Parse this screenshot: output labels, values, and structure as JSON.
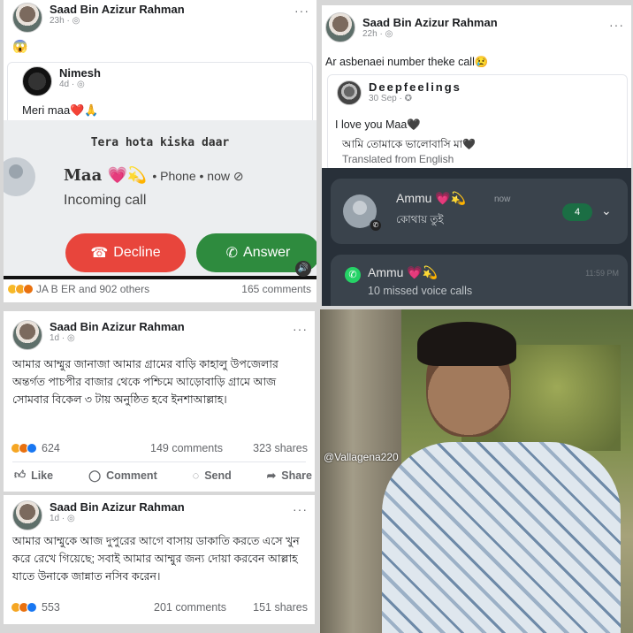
{
  "p1": {
    "author": "Saad Bin Azizur Rahman",
    "time": "23h · ",
    "emoji": "😱",
    "nested_author": "Nimesh",
    "nested_time": "4d · ",
    "nested_text": "Meri maa❤️🙏",
    "caption": "Tera hota kiska daar",
    "caller_name": "Maa 💗💫",
    "call_meta": "• Phone • now ⊘",
    "incoming": "Incoming call",
    "decline": "Decline",
    "answer": "Answer",
    "reactions_text": "JA B ER and 902 others",
    "comments": "165 comments"
  },
  "p2": {
    "author": "Saad Bin Azizur Rahman",
    "time": "22h · ",
    "text": "Ar asbenaei number theke call😢",
    "nested_author": "Deepfeelings",
    "nested_time": "30 Sep · ",
    "nested_text": "I love you Maa🖤",
    "bangla_text": "আমি তোমাকে ভালোবাসি মা🖤",
    "translated": "Translated from English",
    "notif1_name": "Ammu 💗💫",
    "notif1_time": "now",
    "notif1_msg": "কোথায় তুই",
    "notif1_count": "4",
    "notif2_name": "Ammu 💗💫",
    "notif2_time": "11:59 PM",
    "notif2_msg": "10 missed voice calls"
  },
  "p3": {
    "author": "Saad Bin Azizur Rahman",
    "time": "1d · ",
    "text": "আমার আম্মুর জানাজা আমার গ্রামের বাড়ি কাহালু উপজেলার অন্তর্গত পাচপীর বাজার থেকে পশ্চিমে আড়োবাড়ি গ্রামে আজ সোমবার বিকেল ৩ টায় অনুষ্ঠিত হবে ইনশাআল্লাহ।",
    "reaction_count": "624",
    "comments": "149 comments",
    "shares": "323 shares",
    "like": "Like",
    "comment": "Comment",
    "send": "Send",
    "share": "Share"
  },
  "p4": {
    "author": "Saad Bin Azizur Rahman",
    "time": "1d · ",
    "text": "আমার আম্মুকে আজ দুপুরের আগে বাসায় ডাকাতি করতে এসে খুন করে রেখে গিয়েছে; সবাই আমার আম্মুর জন্য দোয়া করবেন আল্লাহ যাতে উনাকে জান্নাত নসিব করেন।",
    "reaction_count": "553",
    "comments": "201 comments",
    "shares": "151 shares"
  },
  "photo": {
    "watermark": "@Vallagena220"
  }
}
